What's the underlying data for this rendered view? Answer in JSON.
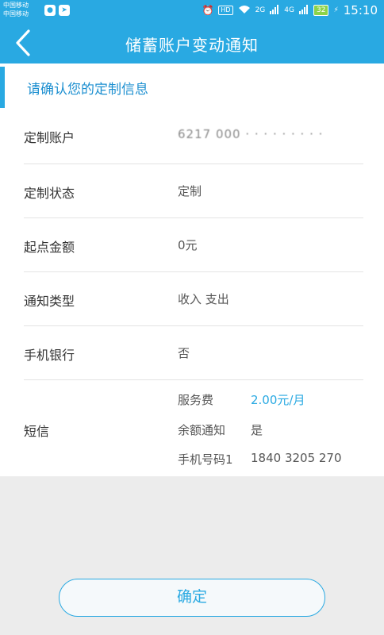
{
  "status_bar": {
    "carrier_1": "中国移动",
    "carrier_2": "中国移动",
    "hd": "HD",
    "net_1": "2G",
    "net_2": "4G",
    "battery": "32",
    "time": "15:10"
  },
  "header": {
    "title": "储蓄账户变动通知"
  },
  "section": {
    "title": "请确认您的定制信息"
  },
  "rows": [
    {
      "label": "定制账户",
      "value": "6217 000 · · · · · · · · ·"
    },
    {
      "label": "定制状态",
      "value": "定制"
    },
    {
      "label": "起点金额",
      "value": "0元"
    },
    {
      "label": "通知类型",
      "value": "收入 支出"
    },
    {
      "label": "手机银行",
      "value": "否"
    }
  ],
  "sms": {
    "label": "短信",
    "fee_label": "服务费",
    "fee_value": "2.00元/月",
    "balance_label": "余额通知",
    "balance_value": "是",
    "phone_label": "手机号码1",
    "phone_value": "1840 3205 270"
  },
  "confirm_button": "确定",
  "colors": {
    "accent": "#29a9e2",
    "background": "#ececec"
  }
}
